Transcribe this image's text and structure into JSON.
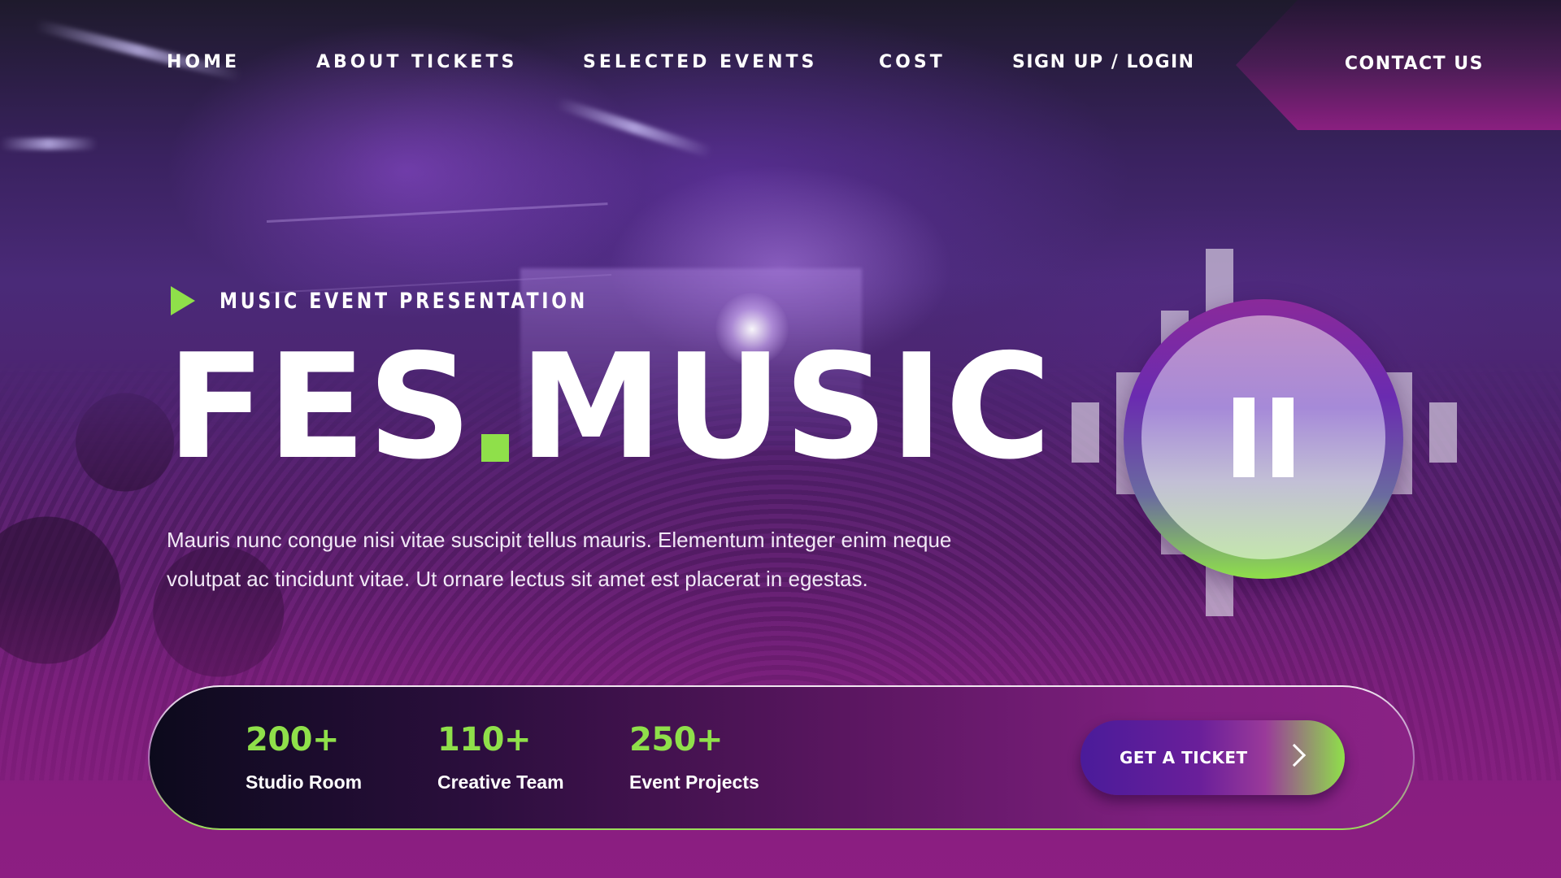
{
  "nav": {
    "items": [
      {
        "label": "HOME"
      },
      {
        "label": "ABOUT TICKETS"
      },
      {
        "label": "SELECTED EVENTS"
      },
      {
        "label": "COST"
      },
      {
        "label": "SIGN UP / LOGIN"
      }
    ],
    "contact_label": "CONTACT US"
  },
  "hero": {
    "eyebrow": "MUSIC EVENT PRESENTATION",
    "title_part1": "FES",
    "title_part2": "MUSIC",
    "description": "Mauris nunc congue nisi vitae suscipit tellus mauris. Elementum integer enim neque volutpat ac tincidunt vitae. Ut ornare lectus sit amet est placerat in egestas."
  },
  "player": {
    "state_icon": "pause-icon"
  },
  "stats": {
    "items": [
      {
        "value": "200+",
        "label": "Studio Room"
      },
      {
        "value": "110+",
        "label": "Creative Team"
      },
      {
        "value": "250+",
        "label": "Event Projects"
      }
    ],
    "cta_label": "GET A TICKET"
  },
  "colors": {
    "accent_green": "#8fe04a",
    "brand_purple": "#6a1f9a",
    "brand_magenta": "#8a1e7f"
  }
}
